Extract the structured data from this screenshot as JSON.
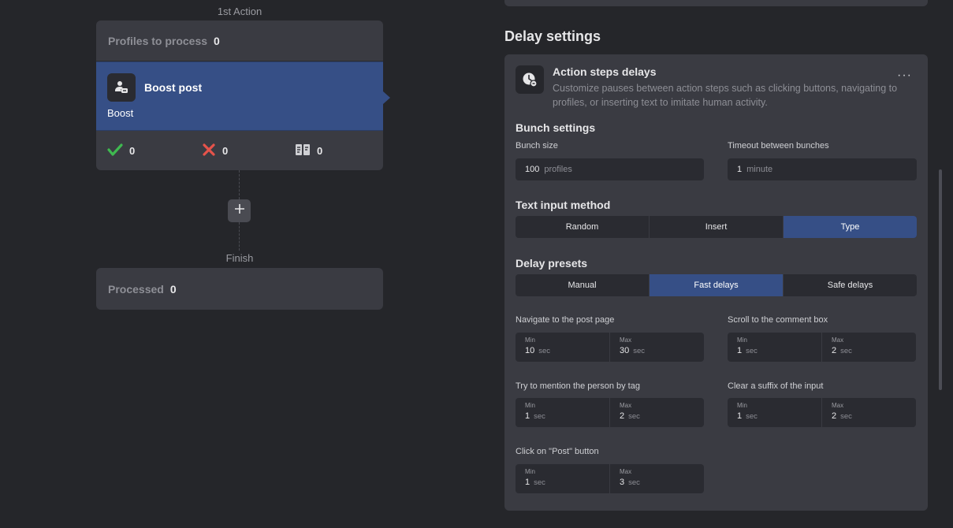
{
  "flow": {
    "step_label": "1st Action",
    "profiles_label": "Profiles to process",
    "profiles_count": "0",
    "action": {
      "icon": "boost-post-icon",
      "title": "Boost post",
      "subtitle": "Boost"
    },
    "stats": {
      "success": "0",
      "failed": "0",
      "skipped": "0"
    },
    "add_label": "+",
    "finish_label": "Finish",
    "processed_label": "Processed",
    "processed_count": "0"
  },
  "settings": {
    "section_title": "Delay settings",
    "panel": {
      "icon": "clock-delay-icon",
      "title": "Action steps delays",
      "description": "Customize pauses between action steps such as clicking buttons, navigating to profiles, or inserting text to imitate human activity.",
      "more_label": "···"
    },
    "bunch": {
      "title": "Bunch settings",
      "size_label": "Bunch size",
      "size_value": "100",
      "size_unit": "profiles",
      "timeout_label": "Timeout between bunches",
      "timeout_value": "1",
      "timeout_unit": "minute"
    },
    "text_input": {
      "title": "Text input method",
      "options": [
        "Random",
        "Insert",
        "Type"
      ],
      "selected": "Type"
    },
    "presets": {
      "title": "Delay presets",
      "options": [
        "Manual",
        "Fast delays",
        "Safe delays"
      ],
      "selected": "Fast delays"
    },
    "delays": [
      {
        "label": "Navigate to the post page",
        "min": "10",
        "max": "30",
        "unit": "sec"
      },
      {
        "label": "Scroll to the comment box",
        "min": "1",
        "max": "2",
        "unit": "sec"
      },
      {
        "label": "Try to mention the person by tag",
        "min": "1",
        "max": "2",
        "unit": "sec"
      },
      {
        "label": "Clear a suffix of the input",
        "min": "1",
        "max": "2",
        "unit": "sec"
      },
      {
        "label": "Click on \"Post\" button",
        "min": "1",
        "max": "3",
        "unit": "sec"
      }
    ],
    "min_label": "Min",
    "max_label": "Max"
  },
  "colors": {
    "accent": "#364f86",
    "success": "#3fb950",
    "error": "#e5534b"
  }
}
